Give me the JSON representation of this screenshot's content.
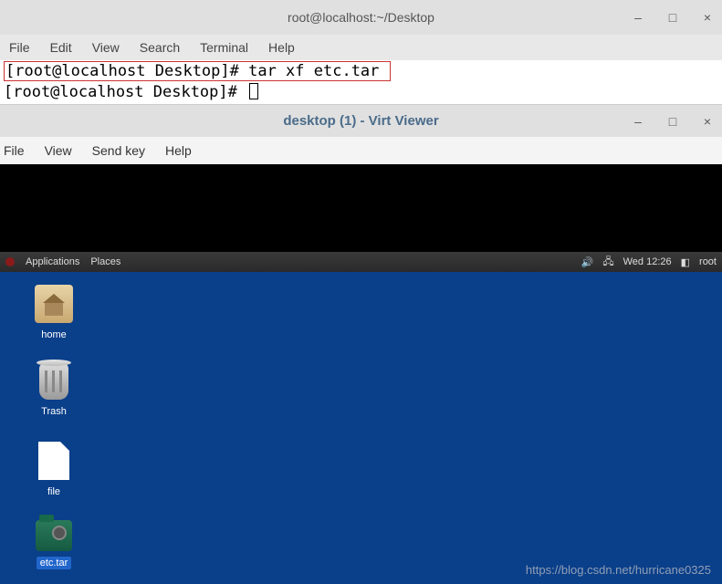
{
  "terminal": {
    "title": "root@localhost:~/Desktop",
    "controls": {
      "minimize": "–",
      "maximize": "□",
      "close": "×"
    },
    "menu": [
      "File",
      "Edit",
      "View",
      "Search",
      "Terminal",
      "Help"
    ],
    "lines": {
      "l1_prompt": "[root@localhost Desktop]#",
      "l1_cmd": " tar xf etc.tar ",
      "l2_prompt": "[root@localhost Desktop]# "
    }
  },
  "virtviewer": {
    "title": "desktop (1) - Virt Viewer",
    "controls": {
      "minimize": "–",
      "maximize": "□",
      "close": "×"
    },
    "menu": [
      "File",
      "View",
      "Send key",
      "Help"
    ]
  },
  "panel": {
    "left": [
      "Applications",
      "Places"
    ],
    "right": {
      "sound_icon": "🔊",
      "network_icon": "🖧",
      "clock": "Wed 12:26",
      "user_icon": "◧",
      "user": "root"
    }
  },
  "desktop": {
    "icons": {
      "home": "home",
      "trash": "Trash",
      "file": "file",
      "etctar": "etc.tar"
    }
  },
  "watermark": "https://blog.csdn.net/hurricane0325"
}
